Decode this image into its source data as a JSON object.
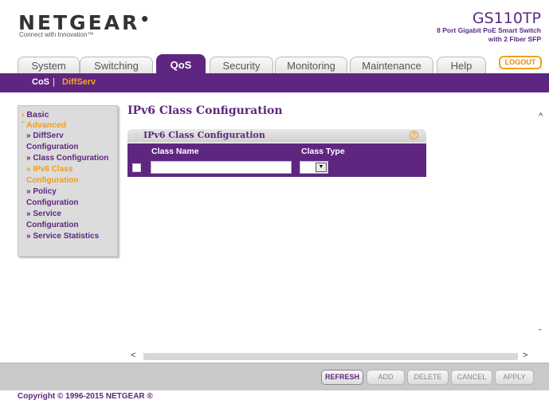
{
  "header": {
    "brand": "NETGEAR",
    "tagline": "Connect with Innovation™",
    "model": "GS110TP",
    "model_desc_1": "8 Port Gigabit PoE Smart Switch",
    "model_desc_2": "with 2 Fiber SFP",
    "logout_label": "LOGOUT"
  },
  "tabs": [
    {
      "label": "System"
    },
    {
      "label": "Switching"
    },
    {
      "label": "QoS"
    },
    {
      "label": "Security"
    },
    {
      "label": "Monitoring"
    },
    {
      "label": "Maintenance"
    },
    {
      "label": "Help"
    }
  ],
  "subnav": {
    "items": [
      {
        "label": "CoS"
      },
      {
        "label": "DiffServ"
      }
    ],
    "separator": "|"
  },
  "sidebar": {
    "basic": "Basic",
    "advanced": "Advanced",
    "items": [
      {
        "l1": "» DiffServ",
        "l2": "Configuration"
      },
      {
        "l1": "» Class Configuration",
        "l2": ""
      },
      {
        "l1": "» IPv6 Class",
        "l2": "Configuration"
      },
      {
        "l1": "» Policy",
        "l2": "Configuration"
      },
      {
        "l1": "» Service",
        "l2": "Configuration"
      },
      {
        "l1": "» Service Statistics",
        "l2": ""
      }
    ]
  },
  "main": {
    "title": "IPv6 Class Configuration",
    "panel_title": "IPv6 Class Configuration",
    "help": "?",
    "columns": [
      "Class Name",
      "Class Type"
    ],
    "class_name_value": "",
    "class_type_value": ""
  },
  "buttons": {
    "refresh": "REFRESH",
    "add": "ADD",
    "delete": "DELETE",
    "cancel": "CANCEL",
    "apply": "APPLY"
  },
  "footer": {
    "copyright": "Copyright © 1996-2015 NETGEAR ®"
  },
  "colors": {
    "brand_purple": "#5f2681",
    "accent_orange": "#f29c16"
  }
}
